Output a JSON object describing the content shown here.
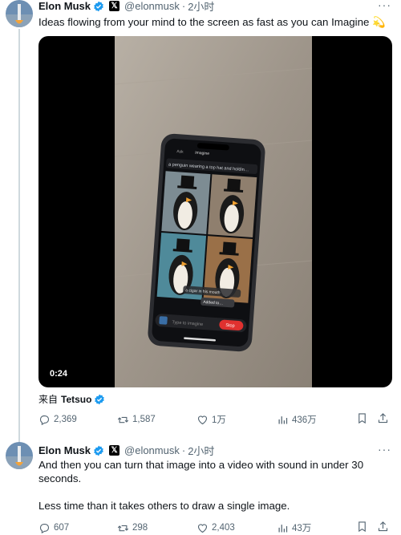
{
  "tweets": [
    {
      "author": "Elon Musk",
      "handle": "@elonmusk",
      "separator": "·",
      "time": "2小时",
      "text": "Ideas flowing from your mind to the screen as fast as you can Imagine",
      "text_emoji": "💫",
      "video": {
        "duration": "0:24",
        "phone_screen": {
          "tabs": [
            "Ask",
            "Imagine"
          ],
          "prompt": "a penguin wearing a top hat and holdin…",
          "edit_prompt": "a cigar in his mouth",
          "added_label": "Added to…",
          "input_placeholder": "Type to imagine",
          "stop_label": "Stop"
        }
      },
      "source_prefix": "来自",
      "source_name": "Tetsuo",
      "stats": {
        "replies": "2,369",
        "reposts": "1,587",
        "likes": "1万",
        "views": "436万"
      }
    },
    {
      "author": "Elon Musk",
      "handle": "@elonmusk",
      "separator": "·",
      "time": "2小时",
      "text": "And then you can turn that image into a video with sound in under 30 seconds.",
      "text2": "Less time than it takes others to draw a single image.",
      "stats": {
        "replies": "607",
        "reposts": "298",
        "likes": "2,403",
        "views": "43万"
      }
    }
  ],
  "colors": {
    "verified": "#1d9bf0",
    "muted": "#536471",
    "thread_line": "#cfd9de"
  },
  "more_label": "···"
}
